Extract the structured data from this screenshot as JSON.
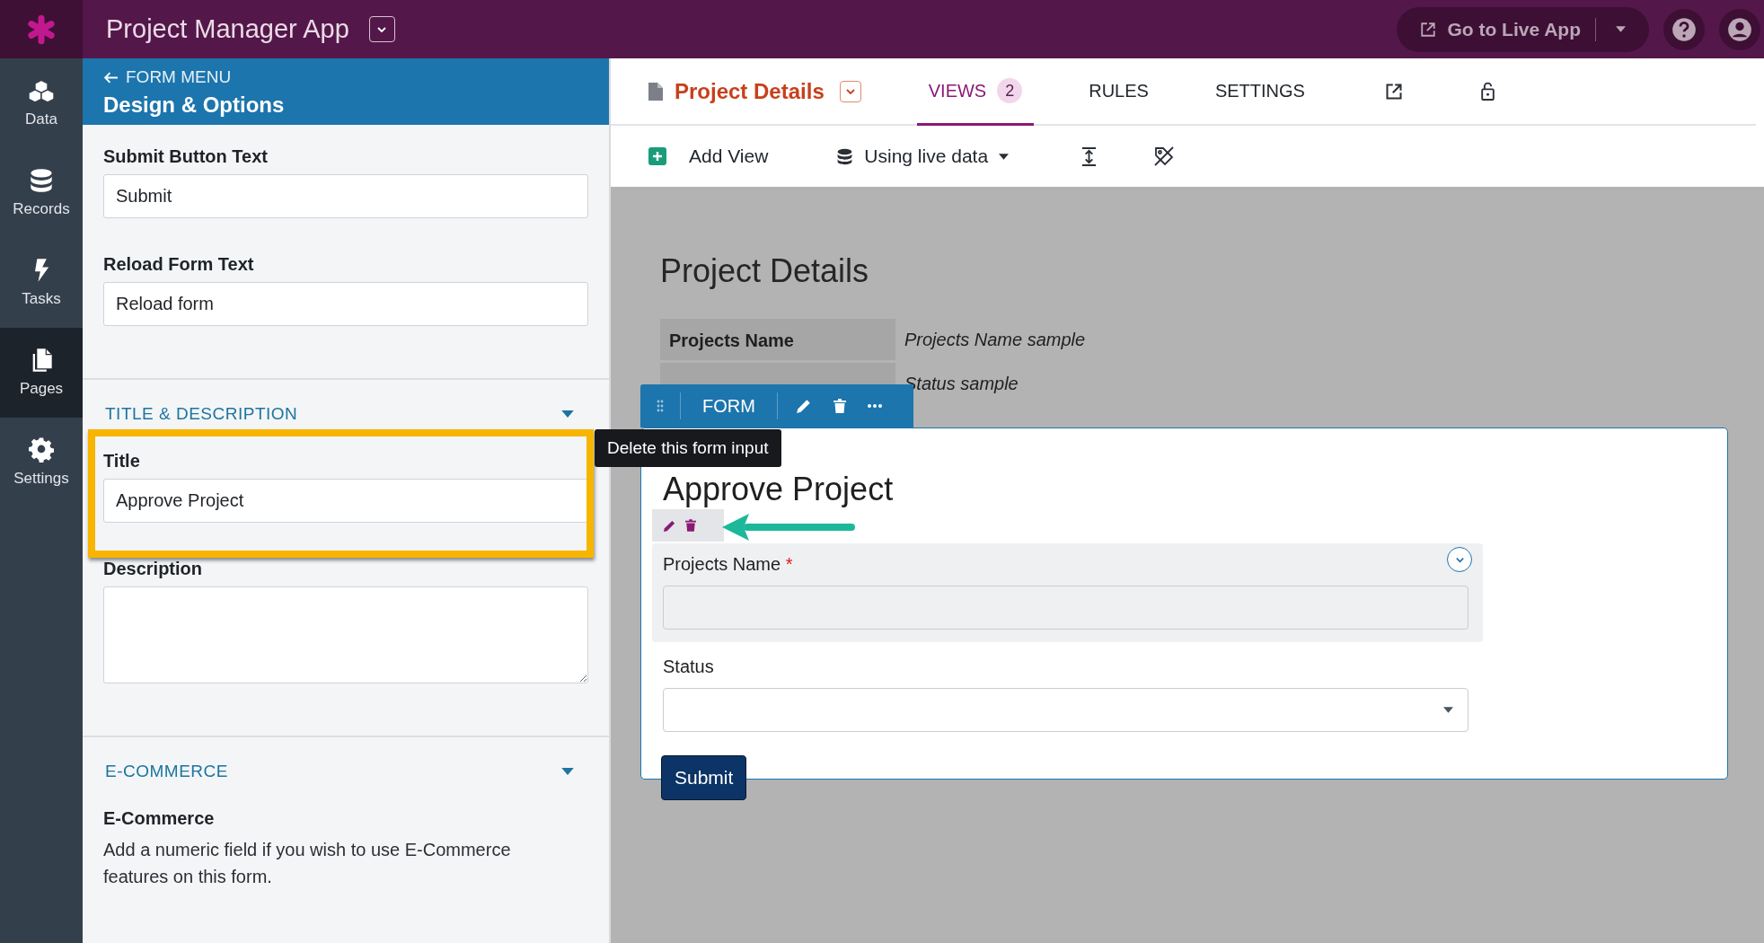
{
  "app": {
    "title": "Project Manager App",
    "live_button": "Go to Live App"
  },
  "nav": [
    {
      "label": "Data",
      "kind": "cubes",
      "selected": false
    },
    {
      "label": "Records",
      "kind": "database",
      "selected": false
    },
    {
      "label": "Tasks",
      "kind": "bolt",
      "selected": false
    },
    {
      "label": "Pages",
      "kind": "pages",
      "selected": true
    },
    {
      "label": "Settings",
      "kind": "gear",
      "selected": false
    }
  ],
  "panel": {
    "back": "FORM MENU",
    "title": "Design & Options",
    "fields": [
      {
        "label": "Submit Button Text",
        "value": "Submit",
        "kind": "input"
      },
      {
        "label": "Reload Form Text",
        "value": "Reload form",
        "kind": "input"
      }
    ],
    "sections": [
      {
        "title": "TITLE & DESCRIPTION",
        "expanded": true,
        "fields": [
          {
            "label": "Title",
            "value": "Approve Project",
            "kind": "input",
            "highlighted": true
          },
          {
            "label": "Description",
            "kind": "textarea"
          }
        ]
      },
      {
        "title": "E-COMMERCE",
        "expanded": true,
        "heading": "E-Commerce",
        "text": "Add a numeric field if you wish to use E-Commerce features on this form."
      }
    ]
  },
  "editor": {
    "page_title": "Project Details",
    "tabs": [
      {
        "label": "VIEWS",
        "badge": "2",
        "selected": true
      },
      {
        "label": "RULES",
        "selected": false
      },
      {
        "label": "SETTINGS",
        "selected": false
      }
    ],
    "add_view": "Add View",
    "data_source": "Using live data"
  },
  "canvas": {
    "heading": "Project Details",
    "details": [
      {
        "label": "Projects Name",
        "value": "Projects Name sample"
      },
      {
        "value": "Status sample"
      }
    ],
    "form": {
      "toolbar_label": "FORM",
      "tooltip": "Delete this form input",
      "title": "Approve Project",
      "fields": [
        {
          "label": "Projects Name",
          "required_mark": "*",
          "kind": "text",
          "selected": true
        },
        {
          "label": "Status",
          "kind": "select",
          "selected": false
        }
      ],
      "submit": "Submit"
    }
  }
}
